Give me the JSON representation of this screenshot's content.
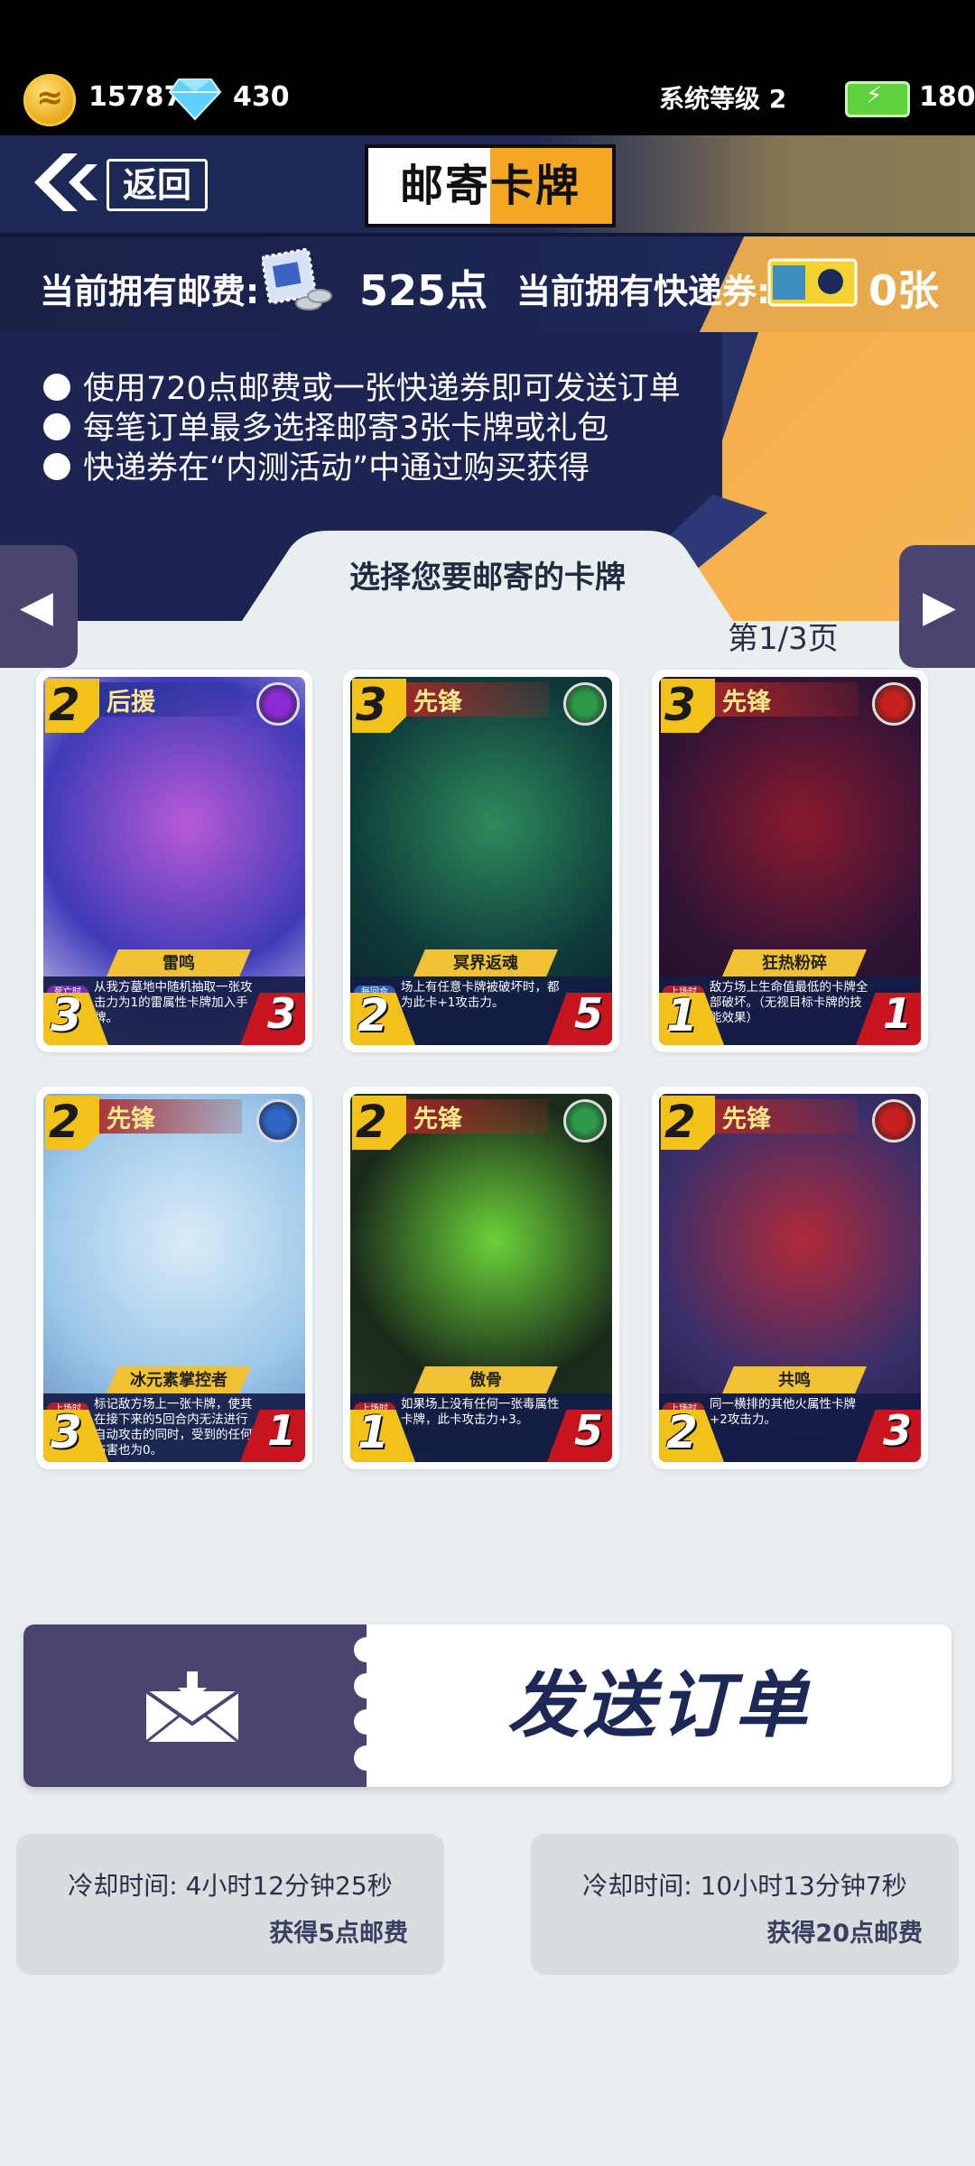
{
  "status": {
    "coins": "157871",
    "diamonds": "430",
    "system_level": "系统等级 2",
    "energy": "180"
  },
  "header": {
    "back_label": "返回",
    "title": "邮寄卡牌"
  },
  "postage": {
    "fee_label": "当前拥有邮费:",
    "fee_value": "525点",
    "ticket_label": "当前拥有快递券:",
    "ticket_value": "0张"
  },
  "rules": [
    "使用720点邮费或一张快递券即可发送订单",
    "每笔订单最多选择邮寄3张卡牌或礼包",
    "快递券在“内测活动”中通过购买获得"
  ],
  "select_title": "选择您要邮寄的卡牌",
  "page_label": "第1/3页",
  "cards": [
    {
      "cost": "2",
      "role": "后援",
      "name": "雷鸣",
      "tag": "死亡时",
      "desc": "从我方墓地中随机抽取一张攻击力为1的雷属性卡牌加入手牌。",
      "attack": "3",
      "hp": "3",
      "element": "lightning-icon",
      "elemColor": "#8b2bd6"
    },
    {
      "cost": "3",
      "role": "先锋",
      "name": "冥界返魂",
      "tag": "每回合",
      "desc": "场上有任意卡牌被破坏时，都为此卡+1攻击力。",
      "attack": "2",
      "hp": "5",
      "element": "toxin-icon",
      "elemColor": "#2e9a48"
    },
    {
      "cost": "3",
      "role": "先锋",
      "name": "狂热粉碎",
      "tag": "上场时",
      "desc": "敌方场上生命值最低的卡牌全部破坏。（无视目标卡牌的技能效果）",
      "attack": "1",
      "hp": "1",
      "element": "fire-icon",
      "elemColor": "#c8201e"
    },
    {
      "cost": "2",
      "role": "先锋",
      "name": "冰元素掌控者",
      "tag": "上场时",
      "desc": "标记敌方场上一张卡牌，使其在接下来的5回合内无法进行自动攻击的同时，受到的任何伤害也为0。",
      "attack": "3",
      "hp": "1",
      "element": "ice-icon",
      "elemColor": "#2f67c8"
    },
    {
      "cost": "2",
      "role": "先锋",
      "name": "傲骨",
      "tag": "上场时",
      "desc": "如果场上没有任何一张毒属性卡牌，此卡攻击力+3。",
      "attack": "1",
      "hp": "5",
      "element": "toxin-icon",
      "elemColor": "#2e9a48"
    },
    {
      "cost": "2",
      "role": "先锋",
      "name": "共鸣",
      "tag": "上场时",
      "desc": "同一横排的其他火属性卡牌+2攻击力。",
      "attack": "2",
      "hp": "3",
      "element": "fire-icon",
      "elemColor": "#c8201e"
    }
  ],
  "send_button": "发送订单",
  "cooldowns": [
    {
      "time": "冷却时间: 4小时12分钟25秒",
      "reward": "获得5点邮费"
    },
    {
      "time": "冷却时间: 10小时13分钟7秒",
      "reward": "获得20点邮费"
    }
  ],
  "colors": {
    "navy": "#1d2452",
    "orange": "#f4b04a",
    "purple": "#4b4470",
    "background": "#e9eef1"
  }
}
